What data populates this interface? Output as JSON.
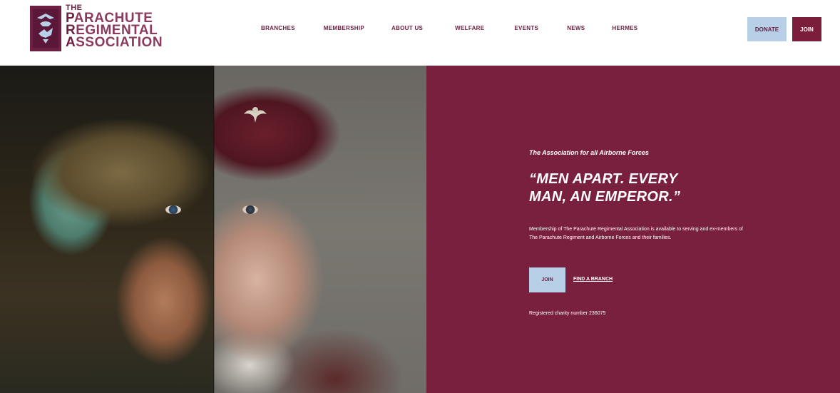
{
  "logo": {
    "the": "THE",
    "line1_first": "P",
    "line1_rest": "ARACHUTE",
    "line2_first": "R",
    "line2_rest": "EGIMENTAL",
    "line3_first": "A",
    "line3_rest": "SSOCIATION"
  },
  "nav": {
    "items": [
      "BRANCHES",
      "MEMBERSHIP",
      "ABOUT US",
      "WELFARE",
      "EVENTS",
      "NEWS",
      "HERMES"
    ]
  },
  "header": {
    "donate_label": "DONATE",
    "join_label": "JOIN"
  },
  "hero": {
    "tagline": "The Association for all Airborne Forces",
    "headline": "“MEN APART. EVERY MAN, AN EMPEROR.”",
    "intro": "Membership of The Parachute Regimental Association is available to serving and ex-members of The Parachute Regiment and Airborne Forces and their families.",
    "join_label": "JOIN",
    "find_branch_label": "FIND A BRANCH",
    "charity": "Registered charity number 236075"
  },
  "colors": {
    "brand_maroon": "#79203e",
    "light_blue": "#b8cfe8",
    "white": "#ffffff"
  },
  "icons": {
    "logo_emblem": "pegasus-emblem-icon",
    "beret_badge": "parachute-wings-icon"
  }
}
